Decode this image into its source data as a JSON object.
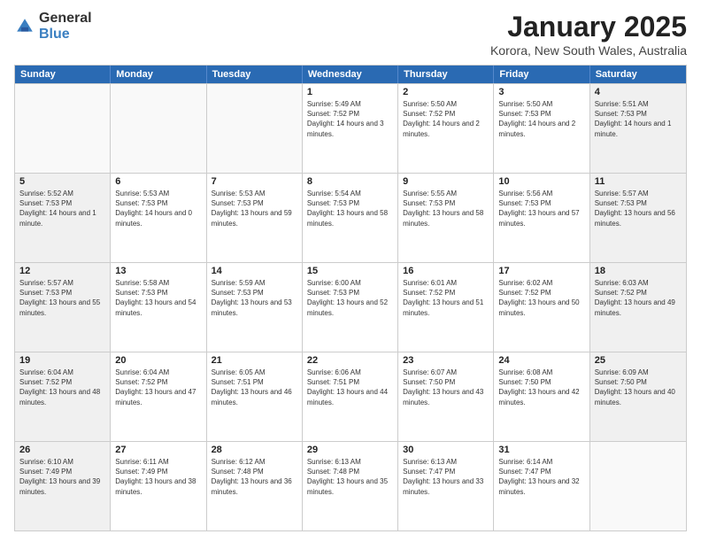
{
  "logo": {
    "general": "General",
    "blue": "Blue"
  },
  "title": {
    "month": "January 2025",
    "location": "Korora, New South Wales, Australia"
  },
  "header_days": [
    "Sunday",
    "Monday",
    "Tuesday",
    "Wednesday",
    "Thursday",
    "Friday",
    "Saturday"
  ],
  "rows": [
    [
      {
        "num": "",
        "sunrise": "",
        "sunset": "",
        "daylight": "",
        "empty": true
      },
      {
        "num": "",
        "sunrise": "",
        "sunset": "",
        "daylight": "",
        "empty": true
      },
      {
        "num": "",
        "sunrise": "",
        "sunset": "",
        "daylight": "",
        "empty": true
      },
      {
        "num": "1",
        "sunrise": "Sunrise: 5:49 AM",
        "sunset": "Sunset: 7:52 PM",
        "daylight": "Daylight: 14 hours and 3 minutes."
      },
      {
        "num": "2",
        "sunrise": "Sunrise: 5:50 AM",
        "sunset": "Sunset: 7:52 PM",
        "daylight": "Daylight: 14 hours and 2 minutes."
      },
      {
        "num": "3",
        "sunrise": "Sunrise: 5:50 AM",
        "sunset": "Sunset: 7:53 PM",
        "daylight": "Daylight: 14 hours and 2 minutes."
      },
      {
        "num": "4",
        "sunrise": "Sunrise: 5:51 AM",
        "sunset": "Sunset: 7:53 PM",
        "daylight": "Daylight: 14 hours and 1 minute."
      }
    ],
    [
      {
        "num": "5",
        "sunrise": "Sunrise: 5:52 AM",
        "sunset": "Sunset: 7:53 PM",
        "daylight": "Daylight: 14 hours and 1 minute."
      },
      {
        "num": "6",
        "sunrise": "Sunrise: 5:53 AM",
        "sunset": "Sunset: 7:53 PM",
        "daylight": "Daylight: 14 hours and 0 minutes."
      },
      {
        "num": "7",
        "sunrise": "Sunrise: 5:53 AM",
        "sunset": "Sunset: 7:53 PM",
        "daylight": "Daylight: 13 hours and 59 minutes."
      },
      {
        "num": "8",
        "sunrise": "Sunrise: 5:54 AM",
        "sunset": "Sunset: 7:53 PM",
        "daylight": "Daylight: 13 hours and 58 minutes."
      },
      {
        "num": "9",
        "sunrise": "Sunrise: 5:55 AM",
        "sunset": "Sunset: 7:53 PM",
        "daylight": "Daylight: 13 hours and 58 minutes."
      },
      {
        "num": "10",
        "sunrise": "Sunrise: 5:56 AM",
        "sunset": "Sunset: 7:53 PM",
        "daylight": "Daylight: 13 hours and 57 minutes."
      },
      {
        "num": "11",
        "sunrise": "Sunrise: 5:57 AM",
        "sunset": "Sunset: 7:53 PM",
        "daylight": "Daylight: 13 hours and 56 minutes."
      }
    ],
    [
      {
        "num": "12",
        "sunrise": "Sunrise: 5:57 AM",
        "sunset": "Sunset: 7:53 PM",
        "daylight": "Daylight: 13 hours and 55 minutes."
      },
      {
        "num": "13",
        "sunrise": "Sunrise: 5:58 AM",
        "sunset": "Sunset: 7:53 PM",
        "daylight": "Daylight: 13 hours and 54 minutes."
      },
      {
        "num": "14",
        "sunrise": "Sunrise: 5:59 AM",
        "sunset": "Sunset: 7:53 PM",
        "daylight": "Daylight: 13 hours and 53 minutes."
      },
      {
        "num": "15",
        "sunrise": "Sunrise: 6:00 AM",
        "sunset": "Sunset: 7:53 PM",
        "daylight": "Daylight: 13 hours and 52 minutes."
      },
      {
        "num": "16",
        "sunrise": "Sunrise: 6:01 AM",
        "sunset": "Sunset: 7:52 PM",
        "daylight": "Daylight: 13 hours and 51 minutes."
      },
      {
        "num": "17",
        "sunrise": "Sunrise: 6:02 AM",
        "sunset": "Sunset: 7:52 PM",
        "daylight": "Daylight: 13 hours and 50 minutes."
      },
      {
        "num": "18",
        "sunrise": "Sunrise: 6:03 AM",
        "sunset": "Sunset: 7:52 PM",
        "daylight": "Daylight: 13 hours and 49 minutes."
      }
    ],
    [
      {
        "num": "19",
        "sunrise": "Sunrise: 6:04 AM",
        "sunset": "Sunset: 7:52 PM",
        "daylight": "Daylight: 13 hours and 48 minutes."
      },
      {
        "num": "20",
        "sunrise": "Sunrise: 6:04 AM",
        "sunset": "Sunset: 7:52 PM",
        "daylight": "Daylight: 13 hours and 47 minutes."
      },
      {
        "num": "21",
        "sunrise": "Sunrise: 6:05 AM",
        "sunset": "Sunset: 7:51 PM",
        "daylight": "Daylight: 13 hours and 46 minutes."
      },
      {
        "num": "22",
        "sunrise": "Sunrise: 6:06 AM",
        "sunset": "Sunset: 7:51 PM",
        "daylight": "Daylight: 13 hours and 44 minutes."
      },
      {
        "num": "23",
        "sunrise": "Sunrise: 6:07 AM",
        "sunset": "Sunset: 7:50 PM",
        "daylight": "Daylight: 13 hours and 43 minutes."
      },
      {
        "num": "24",
        "sunrise": "Sunrise: 6:08 AM",
        "sunset": "Sunset: 7:50 PM",
        "daylight": "Daylight: 13 hours and 42 minutes."
      },
      {
        "num": "25",
        "sunrise": "Sunrise: 6:09 AM",
        "sunset": "Sunset: 7:50 PM",
        "daylight": "Daylight: 13 hours and 40 minutes."
      }
    ],
    [
      {
        "num": "26",
        "sunrise": "Sunrise: 6:10 AM",
        "sunset": "Sunset: 7:49 PM",
        "daylight": "Daylight: 13 hours and 39 minutes."
      },
      {
        "num": "27",
        "sunrise": "Sunrise: 6:11 AM",
        "sunset": "Sunset: 7:49 PM",
        "daylight": "Daylight: 13 hours and 38 minutes."
      },
      {
        "num": "28",
        "sunrise": "Sunrise: 6:12 AM",
        "sunset": "Sunset: 7:48 PM",
        "daylight": "Daylight: 13 hours and 36 minutes."
      },
      {
        "num": "29",
        "sunrise": "Sunrise: 6:13 AM",
        "sunset": "Sunset: 7:48 PM",
        "daylight": "Daylight: 13 hours and 35 minutes."
      },
      {
        "num": "30",
        "sunrise": "Sunrise: 6:13 AM",
        "sunset": "Sunset: 7:47 PM",
        "daylight": "Daylight: 13 hours and 33 minutes."
      },
      {
        "num": "31",
        "sunrise": "Sunrise: 6:14 AM",
        "sunset": "Sunset: 7:47 PM",
        "daylight": "Daylight: 13 hours and 32 minutes."
      },
      {
        "num": "",
        "sunrise": "",
        "sunset": "",
        "daylight": "",
        "empty": true
      }
    ]
  ]
}
